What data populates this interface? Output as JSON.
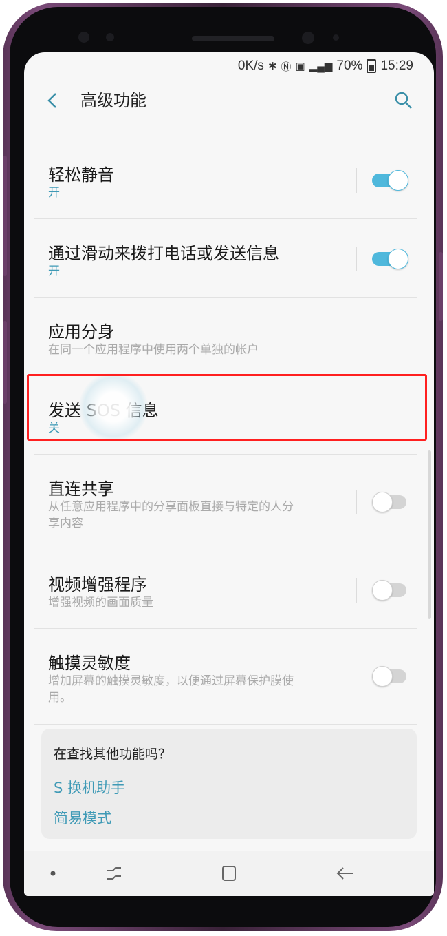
{
  "status_bar": {
    "net_speed": "0K/s",
    "battery": "70%",
    "time": "15:29"
  },
  "header": {
    "title": "高级功能"
  },
  "settings": [
    {
      "title": "轻松静音",
      "subtitle": "开",
      "toggle": "on"
    },
    {
      "title": "通过滑动来拨打电话或发送信息",
      "subtitle": "开",
      "toggle": "on"
    },
    {
      "title": "应用分身",
      "subtitle": "在同一个应用程序中使用两个单独的帐户"
    },
    {
      "title": "发送 SOS 信息",
      "subtitle": "关"
    },
    {
      "title": "直连共享",
      "subtitle": "从任意应用程序中的分享面板直接与特定的人分享内容",
      "toggle": "off"
    },
    {
      "title": "视频增强程序",
      "subtitle": "增强视频的画面质量",
      "toggle": "off"
    },
    {
      "title": "触摸灵敏度",
      "subtitle": "增加屏幕的触摸灵敏度，以便通过屏幕保护膜使用。",
      "toggle": "off"
    }
  ],
  "suggestion_card": {
    "title": "在查找其他功能吗？",
    "links": [
      "S 换机助手",
      "简易模式"
    ]
  },
  "colors": {
    "accent": "#3f9ab6",
    "toggle_on": "#4fb8dc",
    "highlight": "#ff2020",
    "frame": "#6b3f69"
  }
}
